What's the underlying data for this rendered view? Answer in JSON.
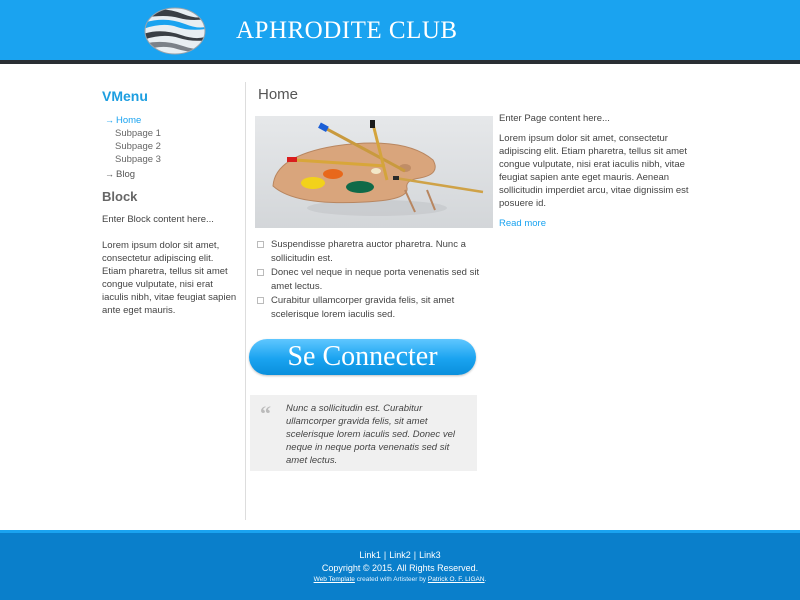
{
  "header": {
    "title": "APHRODITE CLUB",
    "logo_icon": "striped-globe-icon"
  },
  "sidebar": {
    "vmenu_title": "VMenu",
    "items": [
      {
        "label": "Home",
        "level": 1,
        "active": true
      },
      {
        "label": "Subpage 1",
        "level": 2
      },
      {
        "label": "Subpage 2",
        "level": 2
      },
      {
        "label": "Subpage 3",
        "level": 2
      },
      {
        "label": "Blog",
        "level": 1
      }
    ],
    "block_title": "Block",
    "block_intro": "Enter Block content here...",
    "block_text": "Lorem ipsum dolor sit amet, consectetur adipiscing elit. Etiam pharetra, tellus sit amet congue vulputate, nisi erat iaculis nibh, vitae feugiat sapien ante eget mauris."
  },
  "main": {
    "title": "Home",
    "hero_image": "paint-palette-brushes-image",
    "bullets": [
      "Suspendisse pharetra auctor pharetra. Nunc a sollicitudin est.",
      "Donec vel neque in neque porta venenatis sed sit amet lectus.",
      "Curabitur ullamcorper gravida felis, sit amet scelerisque lorem iaculis sed."
    ],
    "connect_button": "Se Connecter",
    "quote": "Nunc a sollicitudin est. Curabitur ullamcorper gravida felis, sit amet scelerisque lorem iaculis sed. Donec vel neque in neque porta venenatis sed sit amet lectus."
  },
  "right": {
    "intro": "Enter Page content here...",
    "text": "Lorem ipsum dolor sit amet, consectetur adipiscing elit. Etiam pharetra, tellus sit amet congue vulputate, nisi erat iaculis nibh, vitae feugiat sapien ante eget mauris. Aenean sollicitudin imperdiet arcu, vitae dignissim est posuere id.",
    "read_more": "Read more"
  },
  "footer": {
    "links": [
      "Link1",
      "Link2",
      "Link3"
    ],
    "separator": "|",
    "copyright": "Copyright © 2015. All Rights Reserved.",
    "credit_link1": "Web Template",
    "credit_mid": " created with Artisteer by ",
    "credit_link2": "Patrick O. F. LIGAN",
    "credit_end": "."
  },
  "colors": {
    "accent": "#1aa3f0",
    "footer_bg": "#0a7fcb",
    "header_rule": "#2a2e33"
  }
}
